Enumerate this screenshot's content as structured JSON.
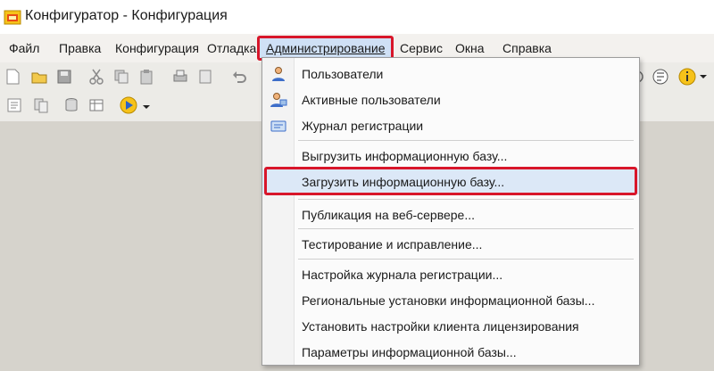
{
  "window": {
    "title": "Конфигуратор - Конфигурация"
  },
  "menu": {
    "items": [
      {
        "id": "file",
        "label": "Файл"
      },
      {
        "id": "edit",
        "label": "Правка"
      },
      {
        "id": "config",
        "label": "Конфигурация"
      },
      {
        "id": "debug",
        "label": "Отладка"
      },
      {
        "id": "admin",
        "label": "Администрирование"
      },
      {
        "id": "service",
        "label": "Сервис"
      },
      {
        "id": "windows",
        "label": "Окна"
      },
      {
        "id": "help",
        "label": "Справка"
      }
    ]
  },
  "dropdown": {
    "items": [
      {
        "label": "Пользователи",
        "icon": "user-icon"
      },
      {
        "label": "Активные пользователи",
        "icon": "active-users-icon"
      },
      {
        "label": "Журнал регистрации",
        "icon": "journal-icon"
      },
      {
        "label": "Выгрузить информационную базу..."
      },
      {
        "label": "Загрузить информационную базу...",
        "selected": true
      },
      {
        "label": "Публикация на веб-сервере..."
      },
      {
        "label": "Тестирование и исправление..."
      },
      {
        "label": "Настройка журнала регистрации..."
      },
      {
        "label": "Региональные установки информационной базы..."
      },
      {
        "label": "Установить настройки клиента лицензирования"
      },
      {
        "label": "Параметры информационной базы..."
      }
    ]
  },
  "colors": {
    "highlight": "#d8162a",
    "selection": "#dce8f7"
  }
}
